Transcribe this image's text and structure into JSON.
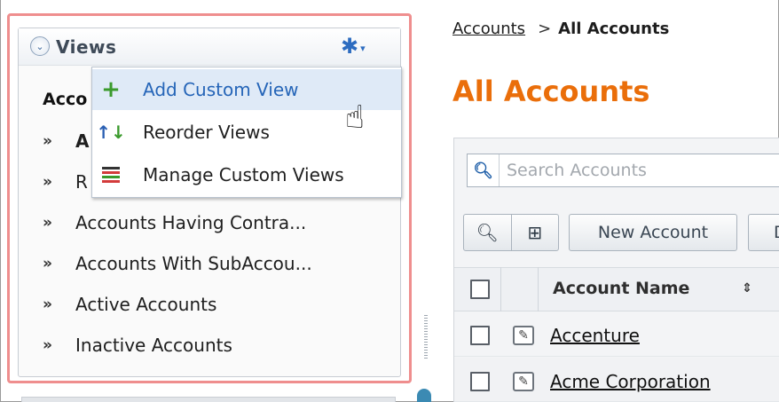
{
  "views_panel": {
    "title": "Views",
    "collapse_glyph": "⌄",
    "gear_glyph": "✱",
    "gear_caret": "▾",
    "list_heading": "Acco",
    "items": [
      {
        "label": "A",
        "bold": true
      },
      {
        "label": "R",
        "bold": false
      },
      {
        "label": "Accounts Having Contra...",
        "bold": false
      },
      {
        "label": "Accounts With SubAccou...",
        "bold": false
      },
      {
        "label": "Active Accounts",
        "bold": false
      },
      {
        "label": "Inactive Accounts",
        "bold": false
      }
    ],
    "chevron": "»"
  },
  "dropdown_menu": {
    "items": [
      {
        "label": "Add Custom View",
        "icon": "plus-icon",
        "hovered": true
      },
      {
        "label": "Reorder Views",
        "icon": "reorder-icon",
        "hovered": false
      },
      {
        "label": "Manage Custom Views",
        "icon": "list-icon",
        "hovered": false
      }
    ]
  },
  "breadcrumb": {
    "parent": "Accounts",
    "separator": ">",
    "current": "All Accounts"
  },
  "page": {
    "title": "All Accounts"
  },
  "search": {
    "placeholder": "Search Accounts",
    "value": ""
  },
  "toolbar": {
    "search_glyph": "⚲",
    "columns_glyph": "⊞",
    "new_account_label": "New Account",
    "next_button_partial": "D"
  },
  "grid": {
    "column_header": "Account Name",
    "sort_glyph": "⇕",
    "edit_glyph": "✎",
    "rows": [
      {
        "name": "Accenture"
      },
      {
        "name": "Acme Corporation"
      }
    ]
  },
  "colors": {
    "title_orange": "#ea6e0a",
    "highlight_border": "#ef8e8e",
    "hover_bg": "#dfeaf7",
    "link_blue": "#2565b8"
  }
}
